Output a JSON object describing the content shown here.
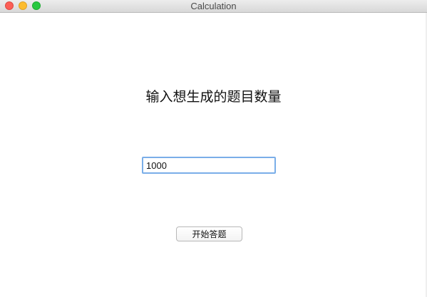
{
  "window": {
    "title": "Calculation"
  },
  "main": {
    "prompt": "输入想生成的题目数量",
    "count_value": "1000",
    "start_button_label": "开始答题"
  },
  "colors": {
    "close": "#fc5f57",
    "minimize": "#fdbc2e",
    "maximize": "#28c840",
    "focus_ring": "#7aaee8"
  }
}
